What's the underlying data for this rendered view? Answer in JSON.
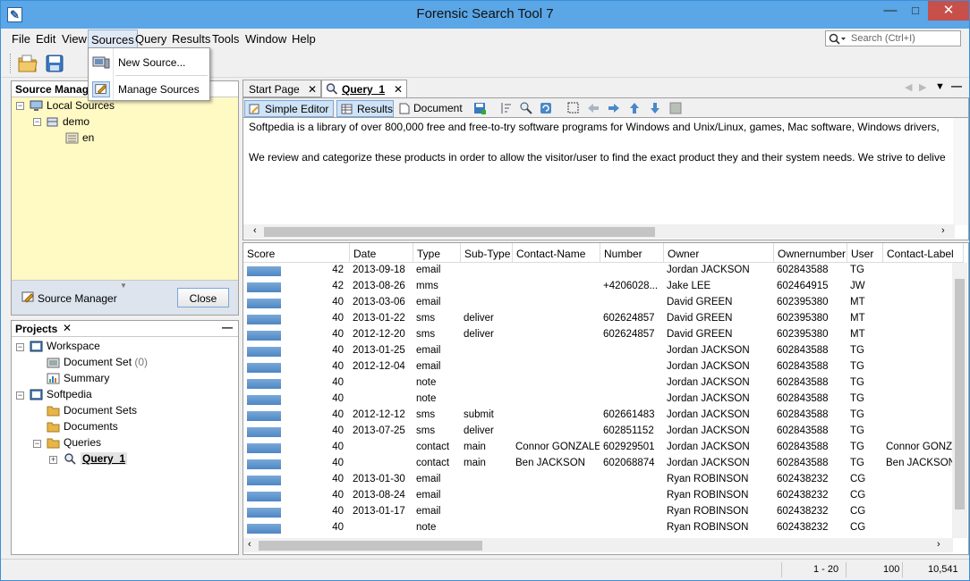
{
  "window": {
    "title": "Forensic Search Tool 7",
    "minimize": "—",
    "maximize": "□",
    "close": "✕"
  },
  "menu": [
    "File",
    "Edit",
    "View",
    "Sources",
    "Query",
    "Results",
    "Tools",
    "Window",
    "Help"
  ],
  "search": {
    "placeholder": "Search (Ctrl+I)"
  },
  "sources_menu": {
    "items": [
      "New Source...",
      "Manage Sources"
    ]
  },
  "source_manager": {
    "title": "Source Manager",
    "tree": [
      {
        "label": "Local Sources"
      },
      {
        "label": "demo"
      },
      {
        "label": "en"
      }
    ],
    "footer_label": "Source Manager",
    "close_button": "Close"
  },
  "projects": {
    "title": "Projects",
    "tree": [
      {
        "label": "Workspace"
      },
      {
        "label": "Document Set",
        "count": "(0)"
      },
      {
        "label": "Summary"
      },
      {
        "label": "Softpedia"
      },
      {
        "label": "Document Sets"
      },
      {
        "label": "Documents"
      },
      {
        "label": "Queries"
      },
      {
        "label": "Query_1"
      }
    ]
  },
  "tabs": [
    {
      "label": "Start Page"
    },
    {
      "label": "Query_1"
    }
  ],
  "query_toolbar": {
    "simple_editor": "Simple Editor",
    "results": "Results",
    "document": "Document"
  },
  "document_text": [
    "Softpedia is a library of over 800,000 free and free-to-try software programs for Windows and Unix/Linux, games, Mac software, Windows drivers, ",
    "We review and categorize these products in order to allow the visitor/user to find the exact product they and their system needs. We strive to delive"
  ],
  "results": {
    "columns": [
      "Score",
      "Date",
      "Type",
      "Sub-Type",
      "Contact-Name",
      "Number",
      "Owner",
      "Ownernumber",
      "User",
      "Contact-Label"
    ],
    "rows": [
      [
        "42",
        "2013-09-18",
        "email",
        "",
        "",
        "",
        "Jordan JACKSON",
        "602843588",
        "TG",
        ""
      ],
      [
        "42",
        "2013-08-26",
        "mms",
        "",
        "",
        "+4206028...",
        "Jake LEE",
        "602464915",
        "JW",
        ""
      ],
      [
        "40",
        "2013-03-06",
        "email",
        "",
        "",
        "",
        "David GREEN",
        "602395380",
        "MT",
        ""
      ],
      [
        "40",
        "2013-01-22",
        "sms",
        "deliver",
        "",
        "602624857",
        "David GREEN",
        "602395380",
        "MT",
        ""
      ],
      [
        "40",
        "2012-12-20",
        "sms",
        "deliver",
        "",
        "602624857",
        "David GREEN",
        "602395380",
        "MT",
        ""
      ],
      [
        "40",
        "2013-01-25",
        "email",
        "",
        "",
        "",
        "Jordan JACKSON",
        "602843588",
        "TG",
        ""
      ],
      [
        "40",
        "2012-12-04",
        "email",
        "",
        "",
        "",
        "Jordan JACKSON",
        "602843588",
        "TG",
        ""
      ],
      [
        "40",
        "",
        "note",
        "",
        "",
        "",
        "Jordan JACKSON",
        "602843588",
        "TG",
        ""
      ],
      [
        "40",
        "",
        "note",
        "",
        "",
        "",
        "Jordan JACKSON",
        "602843588",
        "TG",
        ""
      ],
      [
        "40",
        "2012-12-12",
        "sms",
        "submit",
        "",
        "602661483",
        "Jordan JACKSON",
        "602843588",
        "TG",
        ""
      ],
      [
        "40",
        "2013-07-25",
        "sms",
        "deliver",
        "",
        "602851152",
        "Jordan JACKSON",
        "602843588",
        "TG",
        ""
      ],
      [
        "40",
        "",
        "contact",
        "main",
        "Connor GONZALEZ",
        "602929501",
        "Jordan JACKSON",
        "602843588",
        "TG",
        "Connor GONZA"
      ],
      [
        "40",
        "",
        "contact",
        "main",
        "Ben JACKSON",
        "602068874",
        "Jordan JACKSON",
        "602843588",
        "TG",
        "Ben JACKSON"
      ],
      [
        "40",
        "2013-01-30",
        "email",
        "",
        "",
        "",
        "Ryan ROBINSON",
        "602438232",
        "CG",
        ""
      ],
      [
        "40",
        "2013-08-24",
        "email",
        "",
        "",
        "",
        "Ryan ROBINSON",
        "602438232",
        "CG",
        ""
      ],
      [
        "40",
        "2013-01-17",
        "email",
        "",
        "",
        "",
        "Ryan ROBINSON",
        "602438232",
        "CG",
        ""
      ],
      [
        "40",
        "",
        "note",
        "",
        "",
        "",
        "Ryan ROBINSON",
        "602438232",
        "CG",
        ""
      ]
    ]
  },
  "status": {
    "range": "1 - 20",
    "page_size": "100",
    "total": "10,541"
  }
}
